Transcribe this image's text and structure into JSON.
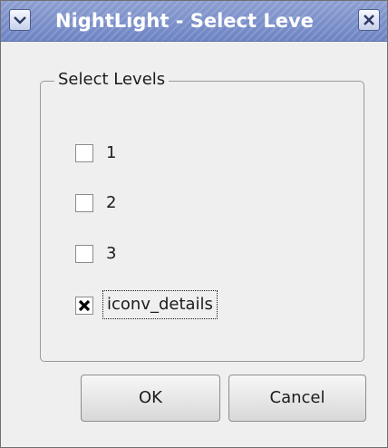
{
  "window": {
    "title": "NightLight - Select Leve"
  },
  "group": {
    "legend": "Select Levels"
  },
  "levels": [
    {
      "label": "1",
      "checked": false,
      "focused": false
    },
    {
      "label": "2",
      "checked": false,
      "focused": false
    },
    {
      "label": "3",
      "checked": false,
      "focused": false
    },
    {
      "label": "iconv_details",
      "checked": true,
      "focused": true
    }
  ],
  "buttons": {
    "ok": "OK",
    "cancel": "Cancel"
  },
  "icons": {
    "window_menu": "chevron-down-icon",
    "window_close": "close-icon",
    "checkbox_mark": "x-check-icon"
  },
  "colors": {
    "titlebar": "#7a8fca",
    "window_bg": "#efefef"
  }
}
